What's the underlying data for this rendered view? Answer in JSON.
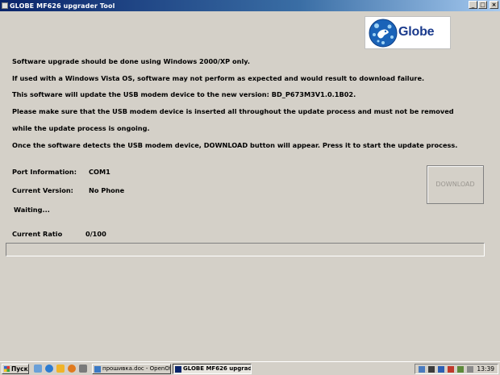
{
  "window": {
    "title": "GLOBE MF626 upgrader Tool",
    "minimize": "_",
    "maximize": "□",
    "close": "×"
  },
  "logo": {
    "text": "Globe"
  },
  "instructions": [
    "Software upgrade should be done using Windows 2000/XP only.",
    "If used with a Windows Vista OS, software may not perform as expected and would result to download failure.",
    "This software will update the USB modem device to the new version: BD_P673M3V1.0.1B02.",
    "Please make sure that the USB modem device is inserted all throughout the update process and  must not be removed",
    "while the update process is ongoing.",
    "Once the software detects the USB modem device, DOWNLOAD button will appear. Press it to start the update process."
  ],
  "info": {
    "port_label": "Port Information:",
    "port_value": "COM1",
    "version_label": "Current  Version:",
    "version_value": "No Phone",
    "status": "Waiting...",
    "ratio_label": "Current Ratio",
    "ratio_value": "0/100"
  },
  "download_label": "DOWNLOAD",
  "progress": 0,
  "taskbar": {
    "start": "Пуск",
    "tasks": [
      {
        "label": "прошивка.doc - OpenOff...",
        "active": false
      },
      {
        "label": "GLOBE MF626 upgrade...",
        "active": true
      }
    ],
    "clock": "13:39"
  },
  "colors": {
    "title_bar": "#0a246a",
    "window_bg": "#d4d0c8",
    "logo_blue": "#1a3a8c"
  }
}
